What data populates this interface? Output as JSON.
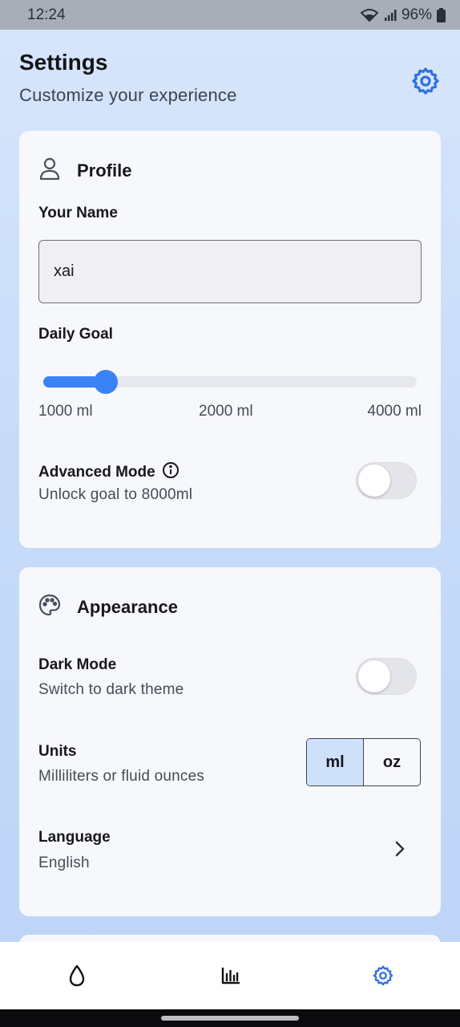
{
  "status_bar": {
    "time": "12:24",
    "battery": "96%"
  },
  "header": {
    "title": "Settings",
    "subtitle": "Customize your experience",
    "icon": "gear-icon"
  },
  "profile": {
    "section_title": "Profile",
    "icon": "user-icon",
    "name_label": "Your Name",
    "name_value": "xai",
    "goal_label": "Daily Goal",
    "goal_slider": {
      "min": 1000,
      "max": 4000,
      "value": 1500,
      "unit": "ml"
    },
    "goal_ticks": [
      "1000 ml",
      "2000 ml",
      "4000 ml"
    ],
    "advanced_label": "Advanced Mode",
    "advanced_sub": "Unlock goal to 8000ml",
    "advanced_on": false
  },
  "appearance": {
    "section_title": "Appearance",
    "icon": "palette-icon",
    "dark_label": "Dark Mode",
    "dark_sub": "Switch to dark theme",
    "dark_on": false,
    "units_label": "Units",
    "units_sub": "Milliliters or fluid ounces",
    "units_options": [
      "ml",
      "oz"
    ],
    "units_selected": "ml",
    "language_label": "Language",
    "language_value": "English"
  },
  "bottom_nav": [
    "water-drop-icon",
    "bar-chart-icon",
    "gear-icon"
  ],
  "colors": {
    "accent": "#3b82f6",
    "selected_bg": "#cfe0fb"
  }
}
